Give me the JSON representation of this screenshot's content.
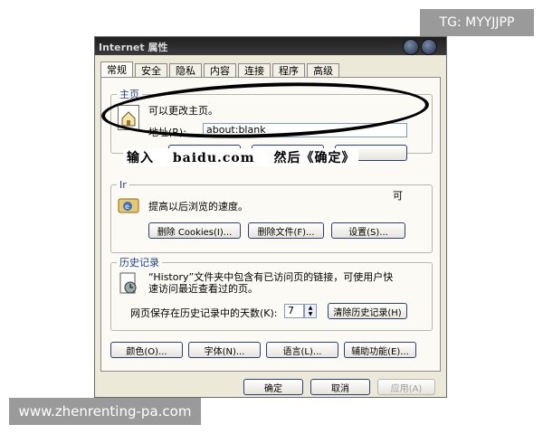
{
  "watermarks": {
    "top_right": "TG: MYYJJPP",
    "bottom_left": "www.zhenrenting-pa.com"
  },
  "window": {
    "title": "Internet 属性"
  },
  "tabs": [
    {
      "label": "常规"
    },
    {
      "label": "安全"
    },
    {
      "label": "隐私"
    },
    {
      "label": "内容"
    },
    {
      "label": "连接"
    },
    {
      "label": "程序"
    },
    {
      "label": "高级"
    }
  ],
  "homepage": {
    "legend": "主页",
    "desc": "可以更改主页。",
    "address_label": "地址(R):",
    "address_value": "about:blank"
  },
  "annotation": "输入　 baidu.com　 然后《确定》",
  "temp_files": {
    "legend": "Ir",
    "desc_partial": "可",
    "desc_line2": "提高以后浏览的速度。",
    "delete_cookies": "删除 Cookies(I)...",
    "delete_files": "删除文件(F)...",
    "settings": "设置(S)..."
  },
  "history": {
    "legend": "历史记录",
    "desc_line1": "“History”文件夹中包含有已访问页的链接，可使用户快",
    "desc_line2": "速访问最近查看过的页。",
    "days_label": "网页保存在历史记录中的天数(K):",
    "days_value": "7",
    "clear_history": "清除历史记录(H)"
  },
  "bottom_buttons": {
    "colors": "颜色(O)...",
    "fonts": "字体(N)...",
    "languages": "语言(L)...",
    "accessibility": "辅助功能(E)..."
  },
  "dialog_buttons": {
    "ok": "确定",
    "cancel": "取消",
    "apply": "应用(A)"
  }
}
